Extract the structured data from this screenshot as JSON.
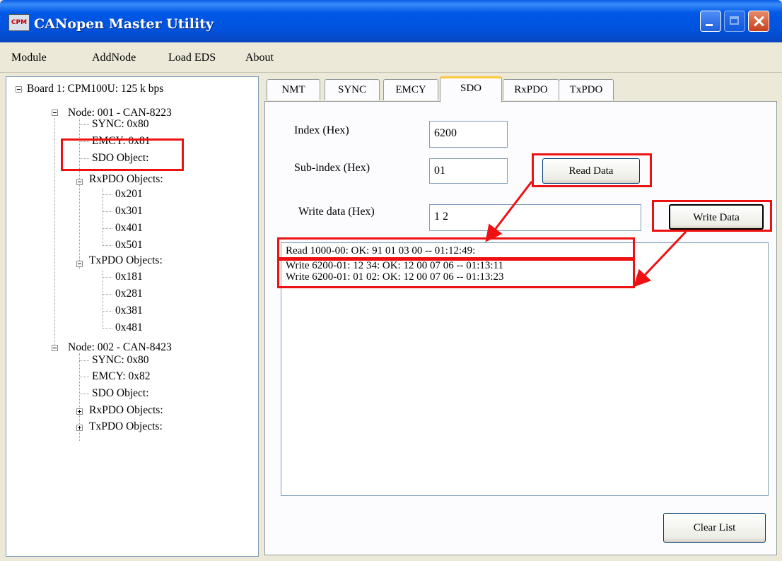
{
  "window": {
    "title": "CANopen Master Utility",
    "icon_label": "CPM"
  },
  "menu": [
    "Module",
    "AddNode",
    "Load EDS",
    "About"
  ],
  "tree": {
    "board": "Board 1: CPM100U:   125 k bps",
    "node1": {
      "label": "Node: 001 - CAN-8223",
      "sync": "SYNC: 0x80",
      "emcy": "EMCY: 0x81",
      "sdo": "SDO Object:",
      "rxpdo": "RxPDO Objects:",
      "rx_items": [
        "0x201",
        "0x301",
        "0x401",
        "0x501"
      ],
      "txpdo": "TxPDO Objects:",
      "tx_items": [
        "0x181",
        "0x281",
        "0x381",
        "0x481"
      ]
    },
    "node2": {
      "label": "Node: 002 - CAN-8423",
      "sync": "SYNC: 0x80",
      "emcy": "EMCY: 0x82",
      "sdo": "SDO Object:",
      "rxpdo": "RxPDO Objects:",
      "txpdo": "TxPDO Objects:"
    }
  },
  "tabs": [
    "NMT",
    "SYNC",
    "EMCY",
    "SDO",
    "RxPDO",
    "TxPDO"
  ],
  "active_tab": "SDO",
  "sdo": {
    "index_label": "Index (Hex)",
    "index_value": "6200",
    "subindex_label": "Sub-index (Hex)",
    "subindex_value": "01",
    "read_button": "Read Data",
    "write_label": "Write data (Hex)",
    "write_value": "1 2",
    "write_button": "Write Data",
    "log": [
      "Read 1000-00: OK: 91 01 03 00 -- 01:12:49:",
      "Write 6200-01: 12 34: OK: 12 00 07 06 -- 01:13:11",
      "Write 6200-01: 01 02: OK: 12 00 07 06 -- 01:13:23"
    ],
    "clear_button": "Clear List"
  },
  "colors": {
    "highlight": "#EE1111",
    "titlebar": "#0058E6",
    "tab_accent": "#FFC83C"
  }
}
